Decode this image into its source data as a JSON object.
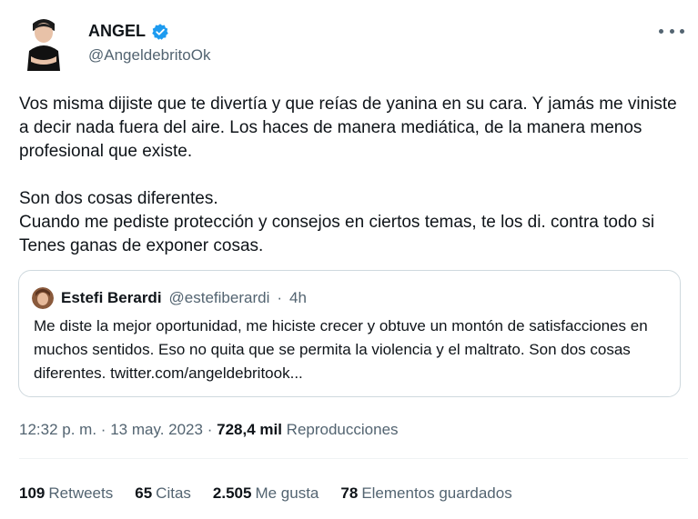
{
  "author": {
    "name": "ANGEL",
    "handle": "@AngeldebritoOk"
  },
  "tweet": {
    "paragraph1": "Vos misma dijiste que te divertía y que reías de yanina en su cara. Y jamás me viniste a decir nada fuera del aire. Los haces de manera mediática, de la manera menos profesional que existe.",
    "paragraph2_line1": "Son dos cosas diferentes.",
    "paragraph2_line2": "Cuando me pediste protección y consejos en ciertos temas, te los di. contra todo si Tenes ganas de exponer cosas."
  },
  "quote": {
    "name": "Estefi Berardi",
    "handle": "@estefiberardi",
    "separator": "·",
    "time": "4h",
    "text": "Me diste la mejor oportunidad, me hiciste crecer y obtuve un montón de satisfacciones en muchos sentidos. Eso no quita que se permita la violencia y el maltrato. Son dos cosas diferentes. twitter.com/angeldebritook..."
  },
  "meta": {
    "time": "12:32 p. m.",
    "sep1": "·",
    "date": "13 may. 2023",
    "sep2": "·",
    "views": "728,4 mil",
    "views_label": "Reproducciones"
  },
  "stats": {
    "retweets": "109",
    "retweets_label": "Retweets",
    "quotes": "65",
    "quotes_label": "Citas",
    "likes": "2.505",
    "likes_label": "Me gusta",
    "bookmarks": "78",
    "bookmarks_label": "Elementos guardados"
  },
  "colors": {
    "verified": "#1d9bf0",
    "secondary_text": "#536471",
    "border": "#cfd9de"
  },
  "icons": {
    "verified": "verified-badge-icon",
    "more": "more-dots-icon"
  }
}
